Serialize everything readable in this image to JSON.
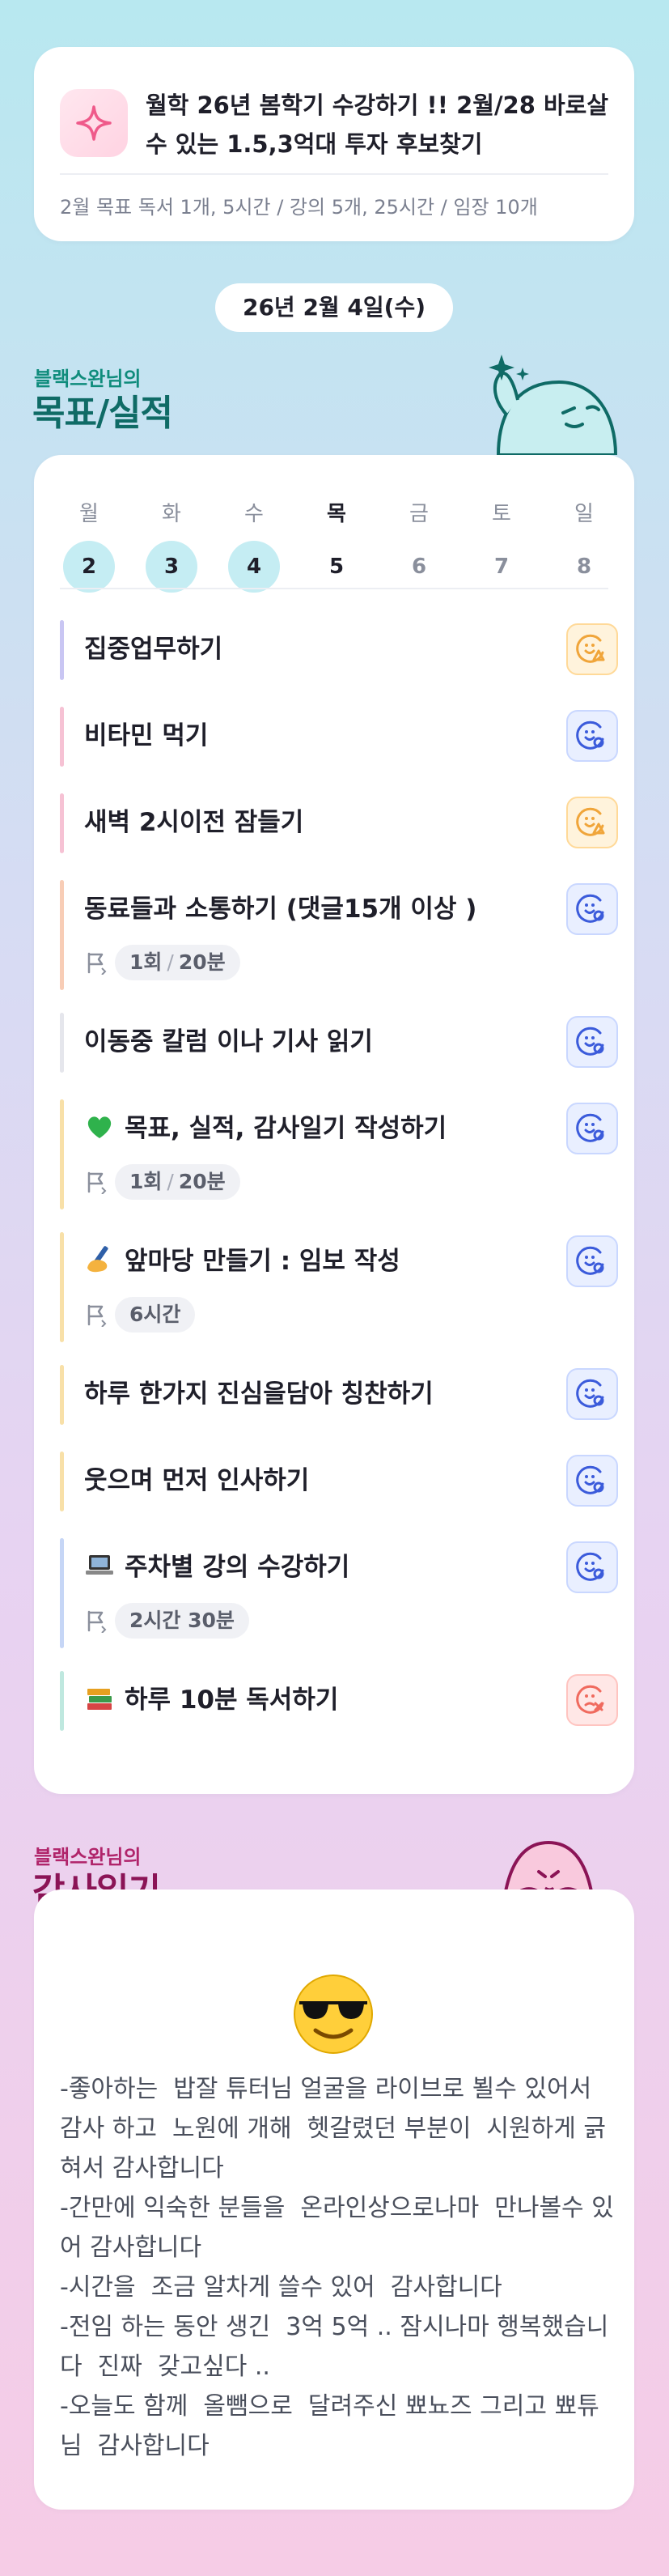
{
  "goal": {
    "title": "월학 26년 봄학기 수강하기 !! 2월/28 바로살수 있는 1.5,3억대 투자 후보찾기",
    "summary": "2월 목표  독서 1개, 5시간 / 강의 5개, 25시간 / 임장 10개",
    "icon": "sparkle-icon"
  },
  "date": "26년 2월 4일(수)",
  "goals_section": {
    "subtitle": "블랙스완님의",
    "title": "목표/실적"
  },
  "week": [
    {
      "name": "월",
      "num": "2",
      "state": "done"
    },
    {
      "name": "화",
      "num": "3",
      "state": "done"
    },
    {
      "name": "수",
      "num": "4",
      "state": "done"
    },
    {
      "name": "목",
      "num": "5",
      "state": "today"
    },
    {
      "name": "금",
      "num": "6",
      "state": "future"
    },
    {
      "name": "토",
      "num": "7",
      "state": "future"
    },
    {
      "name": "일",
      "num": "8",
      "state": "future"
    }
  ],
  "tasks": [
    {
      "name": "집중업무하기",
      "bar_color": "#c9c6f3",
      "status": "warn"
    },
    {
      "name": "비타민 먹기",
      "bar_color": "#f6c2d4",
      "status": "doing"
    },
    {
      "name": "새벽 2시이전 잠들기",
      "bar_color": "#f6c2d4",
      "status": "warn"
    },
    {
      "name": "동료들과 소통하기 (댓글15개 이상 )",
      "bar_color": "#f8cdb6",
      "status": "doing",
      "count": "1회",
      "duration": "20분"
    },
    {
      "name": "이동중 칼럼 이나 기사 읽기",
      "bar_color": "#e5e6ec",
      "status": "doing"
    },
    {
      "name": "목표, 실적, 감사일기 작성하기",
      "bar_color": "#f8e0a8",
      "status": "doing",
      "emoji": "green-heart-icon",
      "count": "1회",
      "duration": "20분"
    },
    {
      "name": "앞마당 만들기 : 임보 작성",
      "bar_color": "#f8e0a8",
      "status": "doing",
      "emoji": "writing-hand-icon",
      "duration": "6시간"
    },
    {
      "name": "하루 한가지 진심을담아 칭찬하기",
      "bar_color": "#f8e0a8",
      "status": "doing"
    },
    {
      "name": "웃으며 먼저 인사하기",
      "bar_color": "#f8e0a8",
      "status": "doing"
    },
    {
      "name": "주차별 강의 수강하기",
      "bar_color": "#c6d6f6",
      "status": "doing",
      "emoji": "laptop-icon",
      "duration": "2시간 30분"
    },
    {
      "name": "하루 10분 독서하기",
      "bar_color": "#bfe8df",
      "status": "fail",
      "emoji": "books-icon"
    }
  ],
  "diary_section": {
    "subtitle": "블랙스완님의",
    "title": "감사일기"
  },
  "diary": {
    "emoji": "sunglasses-face-icon",
    "text": "-좋아하는  밥잘 튜터님 얼굴을 라이브로 뵐수 있어서 감사 하고  노원에 개해  헷갈렸던 부분이  시원하게 긁혀서 감사합니다\n-간만에 익숙한 분들을  온라인상으로나마  만나볼수 있어 감사합니다\n-시간을  조금 알차게 쓸수 있어  감사합니다\n-전임 하는 동안 생긴  3억 5억 .. 잠시나마 행복했습니다  진짜  갖고싶다 ..\n-오늘도 함께  올뺌으로  달려주신 뾰뇨즈 그리고 뾰튜님  감사합니다"
  },
  "colors": {
    "done_day_bg": "#c5edf3",
    "status_doing": "#3b5bdb",
    "status_warn": "#f0a53a",
    "status_fail": "#f06a5e"
  }
}
